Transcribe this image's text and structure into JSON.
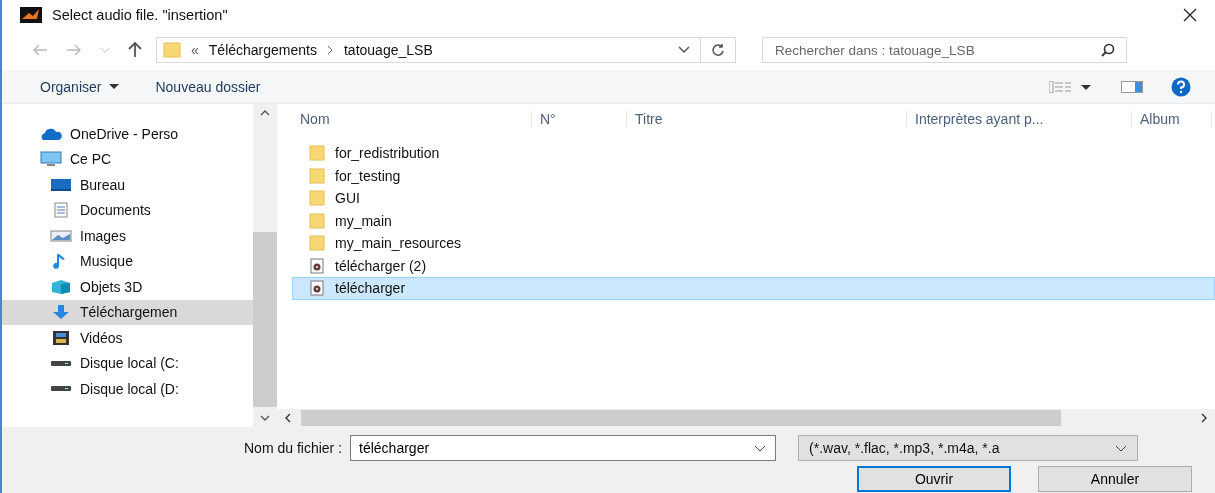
{
  "window": {
    "title": "Select audio file. \"insertion\""
  },
  "address": {
    "overflow": "«",
    "crumbs": [
      "Téléchargements",
      "tatouage_LSB"
    ]
  },
  "search": {
    "placeholder": "Rechercher dans : tatouage_LSB"
  },
  "toolbar": {
    "organize": "Organiser",
    "new_folder": "Nouveau dossier"
  },
  "sidebar": {
    "items": [
      {
        "label": "OneDrive - Perso",
        "kind": "cloud",
        "selected": false
      },
      {
        "label": "Ce PC",
        "kind": "pc",
        "selected": false
      },
      {
        "label": "Bureau",
        "kind": "desktop",
        "selected": false
      },
      {
        "label": "Documents",
        "kind": "document",
        "selected": false
      },
      {
        "label": "Images",
        "kind": "image",
        "selected": false
      },
      {
        "label": "Musique",
        "kind": "music",
        "selected": false
      },
      {
        "label": "Objets 3D",
        "kind": "cube",
        "selected": false
      },
      {
        "label": "Téléchargemen",
        "kind": "download",
        "selected": true
      },
      {
        "label": "Vidéos",
        "kind": "video",
        "selected": false
      },
      {
        "label": "Disque local (C:",
        "kind": "drive",
        "selected": false
      },
      {
        "label": "Disque local (D:",
        "kind": "drive",
        "selected": false
      }
    ]
  },
  "table": {
    "columns": [
      "Nom",
      "N°",
      "Titre",
      "Interprètes ayant p...",
      "Album"
    ],
    "rows": [
      {
        "name": "for_redistribution",
        "kind": "folder",
        "selected": false
      },
      {
        "name": "for_testing",
        "kind": "folder",
        "selected": false
      },
      {
        "name": "GUI",
        "kind": "folder",
        "selected": false
      },
      {
        "name": "my_main",
        "kind": "folder",
        "selected": false
      },
      {
        "name": "my_main_resources",
        "kind": "folder",
        "selected": false
      },
      {
        "name": "télécharger (2)",
        "kind": "audio",
        "selected": false
      },
      {
        "name": "télécharger",
        "kind": "audio",
        "selected": true
      }
    ]
  },
  "footer": {
    "filename_label": "Nom du fichier :",
    "filename": "télécharger",
    "filetype": "(*.wav, *.flac, *.mp3, *.m4a, *.a",
    "buttons": [
      "Ouvrir",
      "Annuler"
    ]
  }
}
